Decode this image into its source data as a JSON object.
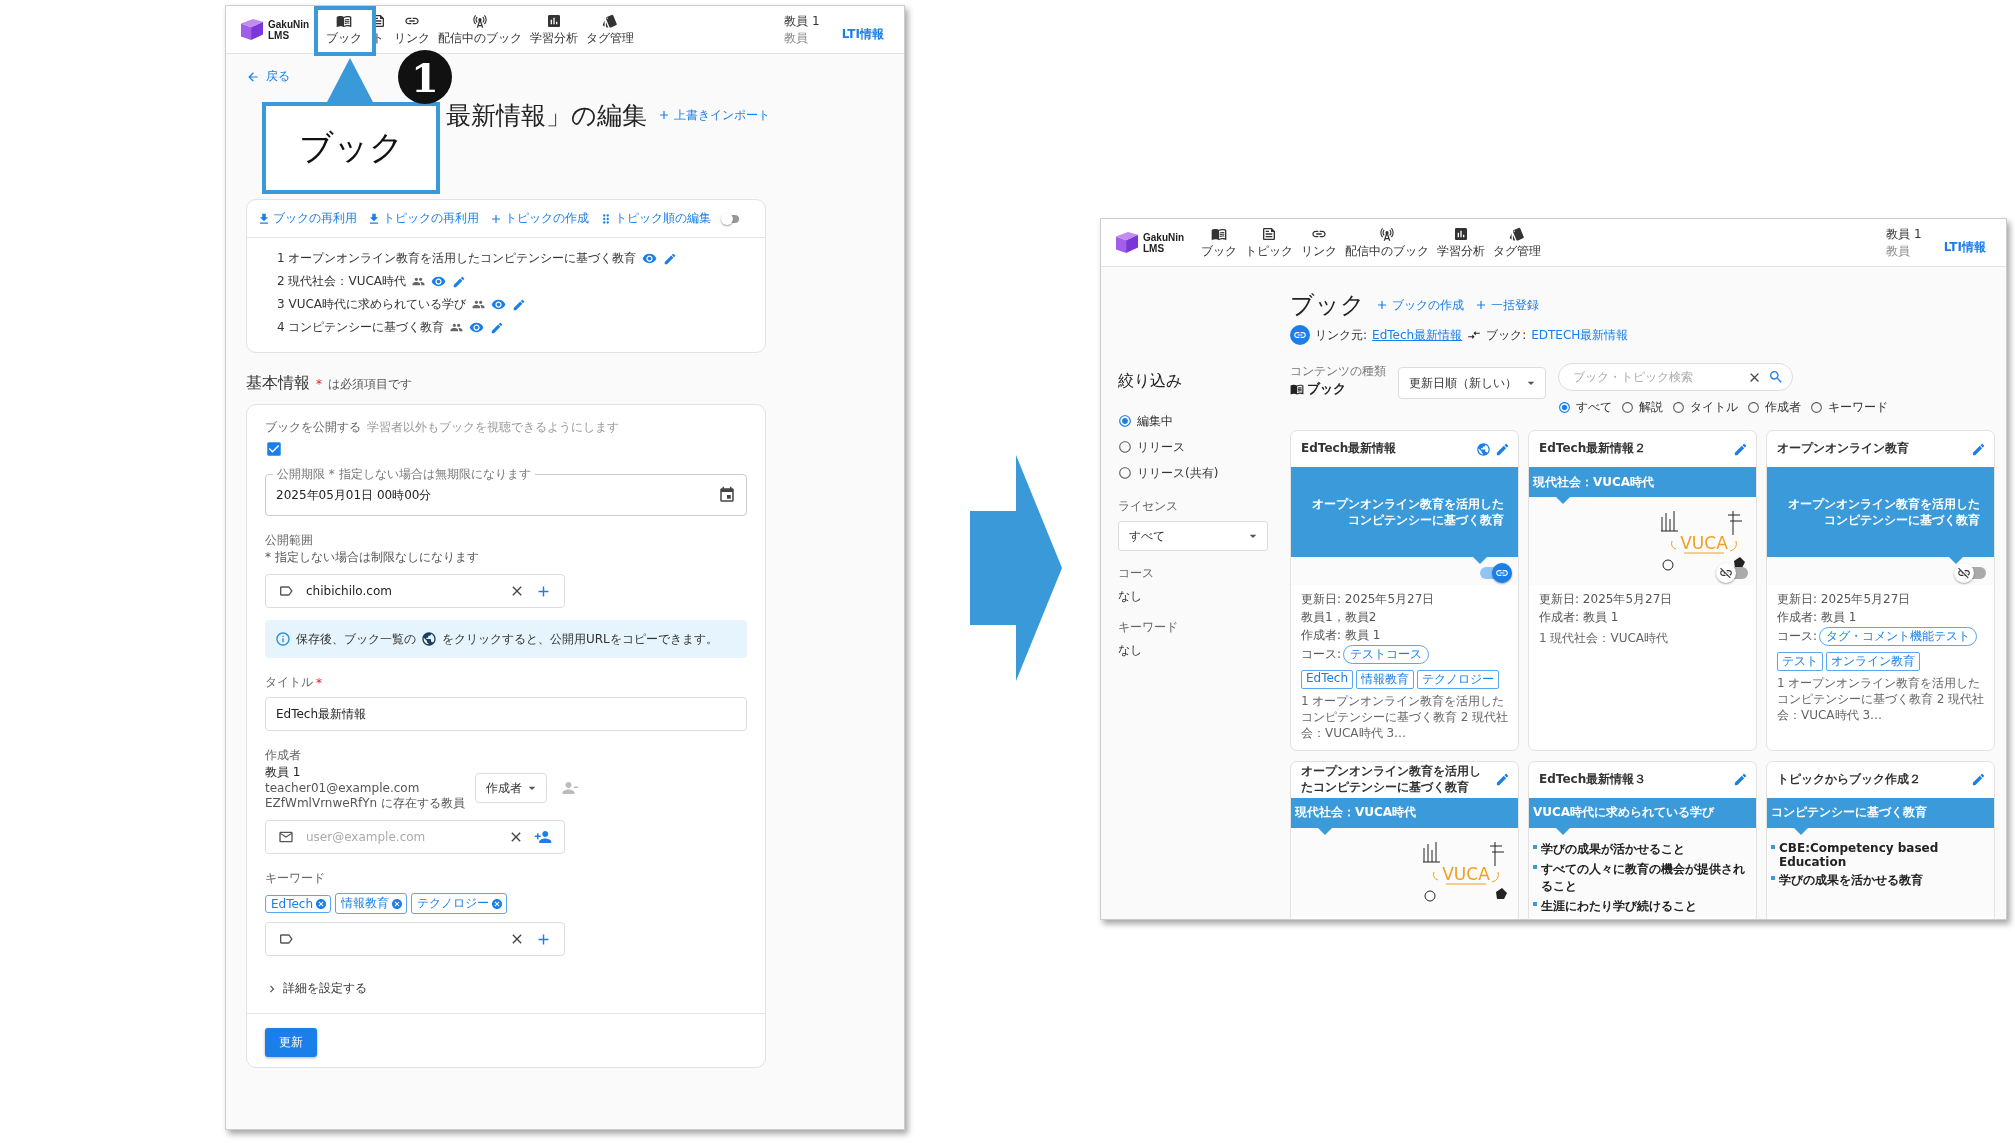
{
  "annotation": {
    "badge": "1",
    "callout": "ブック"
  },
  "edit_screen": {
    "header": {
      "logo": "GakuNin LMS",
      "nav": [
        {
          "label": "ブック",
          "kind": "book"
        },
        {
          "label": "ト",
          "kind": "topic"
        },
        {
          "label": "リンク",
          "kind": "link"
        },
        {
          "label": "配信中のブック",
          "kind": "live"
        },
        {
          "label": "学習分析",
          "kind": "chart"
        },
        {
          "label": "タグ管理",
          "kind": "tags"
        }
      ],
      "user": "教員 1",
      "role": "教員",
      "lti": "LTI情報"
    },
    "back": "戻る",
    "title": "最新情報」の編集",
    "import_link": "上書きインポート",
    "toolbar": [
      {
        "label": "ブックの再利用",
        "kind": "reuse"
      },
      {
        "label": "トピックの再利用",
        "kind": "reuse"
      },
      {
        "label": "トピックの作成",
        "kind": "create"
      },
      {
        "label": "トピック順の編集",
        "kind": "reorder"
      }
    ],
    "reorder_on": false,
    "topics": [
      {
        "label": "1 オープンオンライン教育を活用したコンピテンシーに基づく教育",
        "shared": false
      },
      {
        "label": "2 現代社会：VUCA時代",
        "shared": true
      },
      {
        "label": "3 VUCA時代に求められている学び",
        "shared": true
      },
      {
        "label": "4 コンピテンシーに基づく教育",
        "shared": true
      }
    ],
    "section": {
      "title": "基本情報",
      "required_mark": "*",
      "note": "は必須項目です"
    },
    "publish": {
      "label": "ブックを公開する",
      "hint": "学習者以外もブックを視聴できるようにします",
      "checked": true
    },
    "expiry": {
      "label": "公開期限",
      "note": "* 指定しない場合は無期限になります",
      "value": "2025年05月01日 00時00分"
    },
    "scope": {
      "label": "公開範囲",
      "note": "* 指定しない場合は制限なしになります",
      "value": "chibichilo.com"
    },
    "info": {
      "before": "保存後、ブック一覧の",
      "after": "をクリックすると、公開用URLをコピーできます。"
    },
    "title_field": {
      "label": "タイトル",
      "required_mark": "*",
      "value": "EdTech最新情報"
    },
    "authors": {
      "label": "作成者",
      "name": "教員 1",
      "email": "teacher01@example.com",
      "org": "EZfWmlVrnweRfYn に存在する教員",
      "role": "作成者",
      "placeholder": "user@example.com"
    },
    "keywords": {
      "label": "キーワード",
      "tags": [
        "EdTech",
        "情報教育",
        "テクノロジー"
      ]
    },
    "details": "詳細を設定する",
    "submit": "更新"
  },
  "list_screen": {
    "header": {
      "logo": "GakuNin LMS",
      "nav": [
        {
          "label": "ブック",
          "kind": "book"
        },
        {
          "label": "トピック",
          "kind": "topic"
        },
        {
          "label": "リンク",
          "kind": "link"
        },
        {
          "label": "配信中のブック",
          "kind": "live"
        },
        {
          "label": "学習分析",
          "kind": "chart"
        },
        {
          "label": "タグ管理",
          "kind": "tags"
        }
      ],
      "user": "教員 1",
      "role": "教員",
      "lti": "LTI情報"
    },
    "title": "ブック",
    "actions": [
      "ブックの作成",
      "一括登録"
    ],
    "link_info": {
      "prefix": "リンク元:",
      "source": "EdTech最新情報",
      "book_label": "ブック:",
      "book": "EDTECH最新情報"
    },
    "filter": {
      "title": "絞り込み",
      "status": [
        {
          "label": "編集中",
          "selected": true
        },
        {
          "label": "リリース",
          "selected": false
        },
        {
          "label": "リリース(共有)",
          "selected": false
        }
      ],
      "license": {
        "label": "ライセンス",
        "value": "すべて"
      },
      "course": {
        "label": "コース",
        "value": "なし"
      },
      "keyword": {
        "label": "キーワード",
        "value": "なし"
      }
    },
    "content_type": {
      "label": "コンテンツの種類",
      "value": "ブック"
    },
    "sort": "更新日順（新しい）",
    "search": {
      "placeholder": "ブック・トピック検索"
    },
    "search_scopes": [
      {
        "label": "すべて",
        "selected": true
      },
      {
        "label": "解説",
        "selected": false
      },
      {
        "label": "タイトル",
        "selected": false
      },
      {
        "label": "作成者",
        "selected": false
      },
      {
        "label": "キーワード",
        "selected": false
      }
    ],
    "cards": [
      {
        "title": "EdTech最新情報",
        "public": true,
        "thumbnail": {
          "kind": "title",
          "banner": "オープンオンライン教育を活用したコンピテンシーに基づく教育"
        },
        "shared": true,
        "meta": [
          "更新日: 2025年5月27日",
          "教員1，教員2",
          "作成者: 教員 1"
        ],
        "course_label": "コース:",
        "course": "テストコース",
        "tags": [
          "EdTech",
          "情報教育",
          "テクノロジー"
        ],
        "summary": "1 オープンオンライン教育を活用したコンピテンシーに基づく教育 2 現代社会：VUCA時代 3…"
      },
      {
        "title": "EdTech最新情報２",
        "public": false,
        "thumbnail": {
          "kind": "vuca",
          "banner": "現代社会：VUCA時代",
          "art": "VUCA"
        },
        "shared": false,
        "meta": [
          "更新日: 2025年5月27日",
          "作成者: 教員 1"
        ],
        "summary": "1 現代社会：VUCA時代"
      },
      {
        "title": "オープンオンライン教育",
        "public": false,
        "thumbnail": {
          "kind": "title",
          "banner": "オープンオンライン教育を活用したコンピテンシーに基づく教育"
        },
        "shared": false,
        "meta": [
          "更新日: 2025年5月27日",
          "作成者: 教員 1"
        ],
        "course_label": "コース:",
        "course": "タグ・コメント機能テスト",
        "tags": [
          "テスト",
          "オンライン教育"
        ],
        "summary": "1 オープンオンライン教育を活用したコンピテンシーに基づく教育 2 現代社会：VUCA時代 3…"
      },
      {
        "title": "オープンオンライン教育を活用したコンピテンシーに基づく教育",
        "public": false,
        "thumbnail": {
          "kind": "vuca",
          "banner": "現代社会：VUCA時代",
          "art": "VUCA"
        }
      },
      {
        "title": "EdTech最新情報３",
        "public": false,
        "thumbnail": {
          "kind": "bullets",
          "banner": "VUCA時代に求められている学び",
          "bullets": [
            "学びの成果が活かせること",
            "すべての人々に教育の機会が提供されること",
            "生涯にわたり学び続けること"
          ]
        }
      },
      {
        "title": "トピックからブック作成２",
        "public": false,
        "thumbnail": {
          "kind": "bullets",
          "banner": "コンピテンシーに基づく教育",
          "bullets": [
            "CBE:Competency based Education",
            "学びの成果を活かせる教育"
          ]
        }
      }
    ]
  }
}
